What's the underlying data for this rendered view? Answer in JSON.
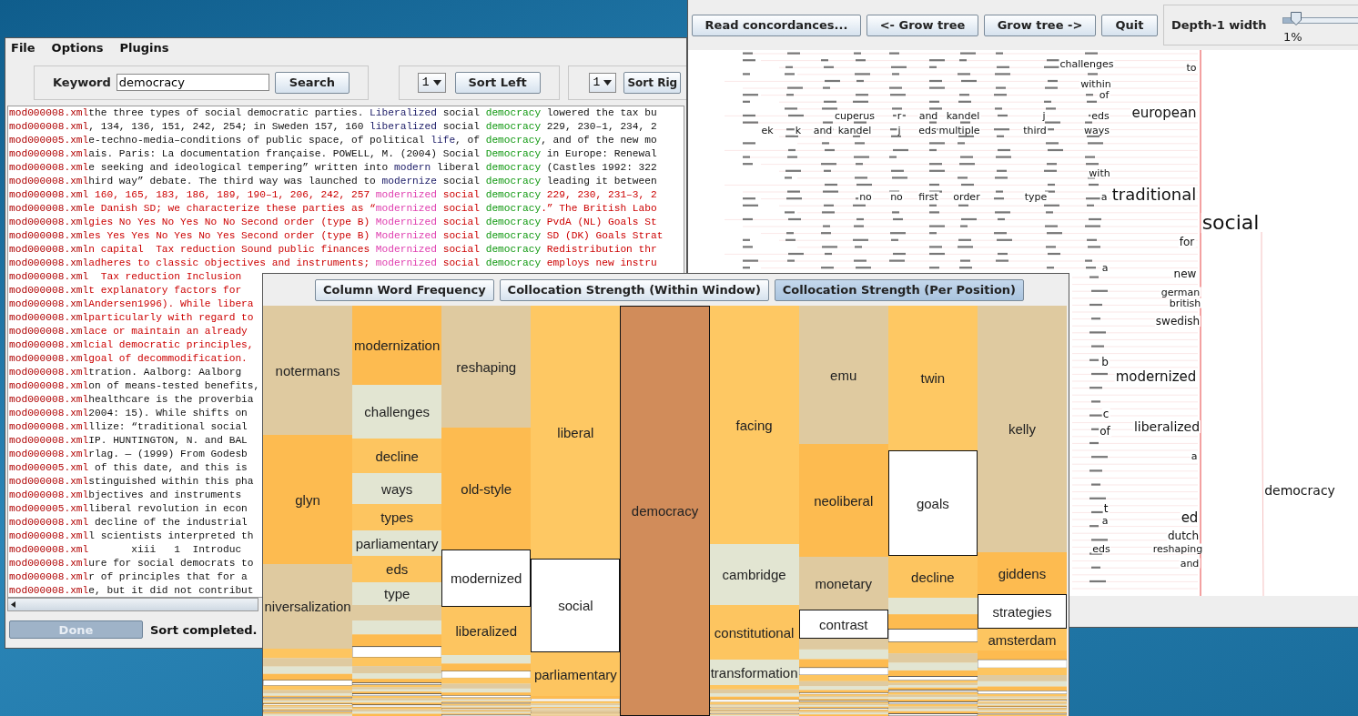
{
  "menu": [
    "File",
    "Options",
    "Plugins"
  ],
  "search": {
    "label": "Keyword",
    "value": "democracy",
    "button": "Search"
  },
  "sort": [
    {
      "depth": "1",
      "button": "Sort Left"
    },
    {
      "depth": "1",
      "button": "Sort Rig"
    }
  ],
  "lines": [
    {
      "file": "mod000008.xml",
      "marked": false,
      "segments": [
        {
          "text": "the three types of social democratic parties. ",
          "kind": "plain"
        },
        {
          "text": "Liberalized",
          "kind": "collocate"
        },
        {
          "text": " social ",
          "kind": "plain"
        },
        {
          "text": "democracy",
          "kind": "keyword"
        },
        {
          "text": " lowered the tax bu",
          "kind": "plain"
        }
      ]
    },
    {
      "file": "mod000008.xml",
      "marked": false,
      "segments": [
        {
          "text": ", 134, 136, 151, 242, 254; in Sweden 157, 160 ",
          "kind": "plain"
        },
        {
          "text": "liberalized",
          "kind": "collocate"
        },
        {
          "text": " social ",
          "kind": "plain"
        },
        {
          "text": "democracy",
          "kind": "keyword"
        },
        {
          "text": " 229, 230–1, 234, 2",
          "kind": "plain"
        }
      ]
    },
    {
      "file": "mod000005.xml",
      "marked": false,
      "segments": [
        {
          "text": "e-techno-media–conditions of public space, of political ",
          "kind": "plain"
        },
        {
          "text": "life",
          "kind": "collocate"
        },
        {
          "text": ", of ",
          "kind": "plain"
        },
        {
          "text": "democracy",
          "kind": "keyword"
        },
        {
          "text": ", and of the new mo",
          "kind": "plain"
        }
      ]
    },
    {
      "file": "mod000008.xml",
      "marked": false,
      "segments": [
        {
          "text": "ais. Paris: La documentation française. POWELL, M. (2004) Social ",
          "kind": "plain"
        },
        {
          "text": "Democracy",
          "kind": "keyword"
        },
        {
          "text": " in Europe: Renewal",
          "kind": "plain"
        }
      ]
    },
    {
      "file": "mod000008.xml",
      "marked": false,
      "segments": [
        {
          "text": "e seeking and ideological tempering” written into ",
          "kind": "plain"
        },
        {
          "text": "modern",
          "kind": "collocate"
        },
        {
          "text": " liberal ",
          "kind": "plain"
        },
        {
          "text": "democracy",
          "kind": "keyword"
        },
        {
          "text": " (Castles 1992: 322",
          "kind": "plain"
        }
      ]
    },
    {
      "file": "mod000008.xml",
      "marked": false,
      "segments": [
        {
          "text": "hird way” debate. The third way was launched to ",
          "kind": "plain"
        },
        {
          "text": "modernize",
          "kind": "collocate"
        },
        {
          "text": " social ",
          "kind": "plain"
        },
        {
          "text": "democracy",
          "kind": "keyword"
        },
        {
          "text": " leading it between",
          "kind": "plain"
        }
      ]
    },
    {
      "file": "mod000008.xml",
      "marked": true,
      "segments": [
        {
          "text": " 160, 165, 183, 186, 189, 190–1, 206, 242, 257 ",
          "kind": "plain"
        },
        {
          "text": "modernized",
          "kind": "collocate"
        },
        {
          "text": " social ",
          "kind": "plain"
        },
        {
          "text": "democracy",
          "kind": "keyword"
        },
        {
          "text": " 229, 230, 231–3, 2",
          "kind": "plain"
        }
      ]
    },
    {
      "file": "mod000008.xml",
      "marked": true,
      "segments": [
        {
          "text": "e Danish SD; we characterize these parties as “",
          "kind": "plain"
        },
        {
          "text": "modernized",
          "kind": "collocate"
        },
        {
          "text": " social ",
          "kind": "plain"
        },
        {
          "text": "democracy",
          "kind": "keyword"
        },
        {
          "text": ".” The British Labo",
          "kind": "plain"
        }
      ]
    },
    {
      "file": "mod000008.xml",
      "marked": true,
      "segments": [
        {
          "text": "gies No Yes No Yes No No Second order (type B) ",
          "kind": "plain"
        },
        {
          "text": "Modernized",
          "kind": "collocate"
        },
        {
          "text": " social ",
          "kind": "plain"
        },
        {
          "text": "democracy",
          "kind": "keyword"
        },
        {
          "text": " PvdA (NL) Goals St",
          "kind": "plain"
        }
      ]
    },
    {
      "file": "mod000008.xml",
      "marked": true,
      "segments": [
        {
          "text": "es Yes Yes No Yes No Yes Second order (type B) ",
          "kind": "plain"
        },
        {
          "text": "Modernized",
          "kind": "collocate"
        },
        {
          "text": " social ",
          "kind": "plain"
        },
        {
          "text": "democracy",
          "kind": "keyword"
        },
        {
          "text": " SD (DK) Goals Strat",
          "kind": "plain"
        }
      ]
    },
    {
      "file": "mod000008.xml",
      "marked": true,
      "segments": [
        {
          "text": "n capital  Tax reduction Sound public finances ",
          "kind": "plain"
        },
        {
          "text": "Modernized",
          "kind": "collocate"
        },
        {
          "text": " social ",
          "kind": "plain"
        },
        {
          "text": "democracy",
          "kind": "keyword"
        },
        {
          "text": " Redistribution thr",
          "kind": "plain"
        }
      ]
    },
    {
      "file": "mod000008.xml",
      "marked": true,
      "segments": [
        {
          "text": "adheres to classic objectives and instruments; ",
          "kind": "plain"
        },
        {
          "text": "modernized",
          "kind": "collocate"
        },
        {
          "text": " social ",
          "kind": "plain"
        },
        {
          "text": "democracy",
          "kind": "keyword"
        },
        {
          "text": " employs new instru",
          "kind": "plain"
        }
      ]
    },
    {
      "file": "mod000008.xml",
      "marked": true,
      "segments": [
        {
          "text": "  Tax reduction Inclusion",
          "kind": "plain"
        }
      ]
    },
    {
      "file": "mod000008.xml",
      "marked": true,
      "segments": [
        {
          "text": "t explanatory factors for",
          "kind": "plain"
        }
      ]
    },
    {
      "file": "mod000008.xml",
      "marked": true,
      "segments": [
        {
          "text": "Andersen1996). While libera",
          "kind": "plain"
        }
      ]
    },
    {
      "file": "mod000008.xml",
      "marked": true,
      "segments": [
        {
          "text": "particularly with regard to",
          "kind": "plain"
        }
      ]
    },
    {
      "file": "mod000008.xml",
      "marked": true,
      "segments": [
        {
          "text": "ace or maintain an already",
          "kind": "plain"
        }
      ]
    },
    {
      "file": "mod000008.xml",
      "marked": true,
      "segments": [
        {
          "text": "cial democratic principles,",
          "kind": "plain"
        }
      ]
    },
    {
      "file": "mod000008.xml",
      "marked": true,
      "segments": [
        {
          "text": "goal of decommodification.",
          "kind": "plain"
        }
      ]
    },
    {
      "file": "mod000008.xml",
      "marked": false,
      "segments": [
        {
          "text": "tration. Aalborg: Aalborg",
          "kind": "plain"
        }
      ]
    },
    {
      "file": "mod000008.xml",
      "marked": false,
      "segments": [
        {
          "text": "on of means-tested benefits,",
          "kind": "plain"
        }
      ]
    },
    {
      "file": "mod000008.xml",
      "marked": false,
      "segments": [
        {
          "text": "healthcare is the proverbia",
          "kind": "plain"
        }
      ]
    },
    {
      "file": "mod000008.xml",
      "marked": false,
      "segments": [
        {
          "text": "2004: 15). While shifts on",
          "kind": "plain"
        }
      ]
    },
    {
      "file": "mod000008.xml",
      "marked": false,
      "segments": [
        {
          "text": "llize: “traditional social",
          "kind": "plain"
        }
      ]
    },
    {
      "file": "mod000008.xml",
      "marked": false,
      "segments": [
        {
          "text": "IP. HUNTINGTON, N. and BAL",
          "kind": "plain"
        }
      ]
    },
    {
      "file": "mod000008.xml",
      "marked": false,
      "segments": [
        {
          "text": "rlag. — (1999) From Godesb",
          "kind": "plain"
        }
      ]
    },
    {
      "file": "mod000005.xml",
      "marked": false,
      "segments": [
        {
          "text": " of this date, and this is",
          "kind": "plain"
        }
      ]
    },
    {
      "file": "mod000008.xml",
      "marked": false,
      "segments": [
        {
          "text": "stinguished within this pha",
          "kind": "plain"
        }
      ]
    },
    {
      "file": "mod000008.xml",
      "marked": false,
      "segments": [
        {
          "text": "bjectives and instruments",
          "kind": "plain"
        }
      ]
    },
    {
      "file": "mod000005.xml",
      "marked": false,
      "segments": [
        {
          "text": "liberal revolution in econ",
          "kind": "plain"
        }
      ]
    },
    {
      "file": "mod000008.xml",
      "marked": false,
      "segments": [
        {
          "text": " decline of the industrial",
          "kind": "plain"
        }
      ]
    },
    {
      "file": "mod000008.xml",
      "marked": false,
      "segments": [
        {
          "text": "l scientists interpreted th",
          "kind": "plain"
        }
      ]
    },
    {
      "file": "mod000008.xml",
      "marked": false,
      "segments": [
        {
          "text": "       xiii   1  Introduc",
          "kind": "plain"
        }
      ]
    },
    {
      "file": "mod000008.xml",
      "marked": false,
      "segments": [
        {
          "text": "ure for social democrats to",
          "kind": "plain"
        }
      ]
    },
    {
      "file": "mod000008.xml",
      "marked": false,
      "segments": [
        {
          "text": "r of principles that for a",
          "kind": "plain"
        }
      ]
    },
    {
      "file": "mod000008.xml",
      "marked": false,
      "segments": [
        {
          "text": "e, but it did not contribut",
          "kind": "plain"
        }
      ]
    }
  ],
  "status": {
    "button": "Done",
    "message": "Sort completed."
  },
  "tree_window": {
    "buttons": [
      "Read concordances...",
      "<- Grow tree",
      "Grow tree ->",
      "Quit"
    ],
    "slider": {
      "label": "Depth-1 width",
      "level": 0.12,
      "reading": "1%"
    },
    "words": [
      {
        "text": "challenges"
      },
      {
        "text": "to"
      },
      {
        "text": "within"
      },
      {
        "text": "of"
      },
      {
        "text": "cuperus"
      },
      {
        "text": "r"
      },
      {
        "text": "and"
      },
      {
        "text": "kandel"
      },
      {
        "text": "j"
      },
      {
        "text": "eds"
      },
      {
        "text": "european"
      },
      {
        "text": "ek"
      },
      {
        "text": "k"
      },
      {
        "text": "and"
      },
      {
        "text": "kandel"
      },
      {
        "text": "j"
      },
      {
        "text": "eds"
      },
      {
        "text": "multiple"
      },
      {
        "text": "third"
      },
      {
        "text": "ways"
      },
      {
        "text": "with"
      },
      {
        "text": "no"
      },
      {
        "text": "no"
      },
      {
        "text": "first"
      },
      {
        "text": "order"
      },
      {
        "text": "type"
      },
      {
        "text": "a"
      },
      {
        "text": "traditional"
      },
      {
        "text": "social"
      },
      {
        "text": "for"
      },
      {
        "text": "a"
      },
      {
        "text": "new"
      },
      {
        "text": "german"
      },
      {
        "text": "british"
      },
      {
        "text": "swedish"
      },
      {
        "text": "b"
      },
      {
        "text": "modernized"
      },
      {
        "text": "c"
      },
      {
        "text": "of"
      },
      {
        "text": "liberalized"
      },
      {
        "text": "a"
      },
      {
        "text": "democracy"
      },
      {
        "text": "t"
      },
      {
        "text": "a"
      },
      {
        "text": "ed"
      },
      {
        "text": "dutch"
      },
      {
        "text": "eds"
      },
      {
        "text": "reshaping"
      },
      {
        "text": "and"
      }
    ]
  },
  "mosaic": {
    "tabs": [
      {
        "label": "Column Word Frequency",
        "selected": false
      },
      {
        "label": "Collocation Strength (Within Window)",
        "selected": false
      },
      {
        "label": "Collocation Strength (Per Position)",
        "selected": true
      }
    ],
    "columns": [
      {
        "cells": [
          {
            "text": "notermans",
            "color": "#dfcaa0",
            "outlined": false
          },
          {
            "text": "glyn",
            "color": "#fdbb50",
            "outlined": false
          },
          {
            "text": "niversalization",
            "color": "#dfcaa0",
            "outlined": false
          }
        ]
      },
      {
        "cells": [
          {
            "text": "modernization",
            "color": "#fdbb50",
            "outlined": false
          },
          {
            "text": "challenges",
            "color": "#e2e5d2",
            "outlined": false
          },
          {
            "text": "decline",
            "color": "#fdc560",
            "outlined": false
          },
          {
            "text": "ways",
            "color": "#e2e5d2",
            "outlined": false
          },
          {
            "text": "types",
            "color": "#fdc560",
            "outlined": false
          },
          {
            "text": "parliamentary",
            "color": "#e2e5d2",
            "outlined": false
          },
          {
            "text": "eds",
            "color": "#fdc560",
            "outlined": false
          },
          {
            "text": "type",
            "color": "#e2e5d2",
            "outlined": false
          }
        ]
      },
      {
        "cells": [
          {
            "text": "reshaping",
            "color": "#dfcaa0",
            "outlined": false
          },
          {
            "text": "old-style",
            "color": "#fdbb50",
            "outlined": false
          },
          {
            "text": "modernized",
            "color": "#ffffff",
            "outlined": true
          },
          {
            "text": "liberalized",
            "color": "#fdc560",
            "outlined": false
          }
        ]
      },
      {
        "cells": [
          {
            "text": "liberal",
            "color": "#fec863",
            "outlined": false
          },
          {
            "text": "social",
            "color": "#ffffff",
            "outlined": true
          },
          {
            "text": "parliamentary",
            "color": "#fdc560",
            "outlined": false
          }
        ]
      },
      {
        "cells": [
          {
            "text": "democracy",
            "color": "#d18c5a",
            "outlined": true
          }
        ]
      },
      {
        "cells": [
          {
            "text": "facing",
            "color": "#fec863",
            "outlined": false
          },
          {
            "text": "cambridge",
            "color": "#e2e5d2",
            "outlined": false
          },
          {
            "text": "constitutional",
            "color": "#fdc560",
            "outlined": false
          },
          {
            "text": "transformation",
            "color": "#e2e5d2",
            "outlined": false
          }
        ]
      },
      {
        "cells": [
          {
            "text": "emu",
            "color": "#dfcaa0",
            "outlined": false
          },
          {
            "text": "neoliberal",
            "color": "#fdbb50",
            "outlined": false
          },
          {
            "text": "monetary",
            "color": "#dfcaa0",
            "outlined": false
          },
          {
            "text": "contrast",
            "color": "#ffffff",
            "outlined": true
          }
        ]
      },
      {
        "cells": [
          {
            "text": "twin",
            "color": "#fec863",
            "outlined": false
          },
          {
            "text": "goals",
            "color": "#ffffff",
            "outlined": true
          },
          {
            "text": "decline",
            "color": "#fdc560",
            "outlined": false
          }
        ]
      },
      {
        "cells": [
          {
            "text": "kelly",
            "color": "#dfcaa0",
            "outlined": false
          },
          {
            "text": "giddens",
            "color": "#fdbb50",
            "outlined": false
          },
          {
            "text": "strategies",
            "color": "#ffffff",
            "outlined": true
          },
          {
            "text": "amsterdam",
            "color": "#fdc560",
            "outlined": false
          }
        ]
      }
    ]
  }
}
